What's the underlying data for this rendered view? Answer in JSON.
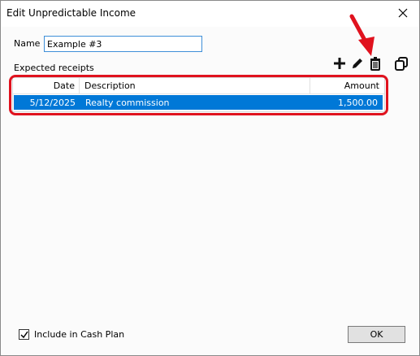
{
  "window": {
    "title": "Edit Unpredictable Income"
  },
  "form": {
    "name_label": "Name",
    "name_value": "Example #3",
    "expected_label": "Expected receipts"
  },
  "grid": {
    "columns": [
      "Date",
      "Description",
      "Amount"
    ],
    "rows": [
      {
        "date": "5/12/2025",
        "description": "Realty commission",
        "amount": "1,500.00",
        "selected": true
      }
    ]
  },
  "toolbar": {
    "icons": [
      "plus-icon",
      "pencil-icon",
      "trash-icon",
      "copy-icon"
    ]
  },
  "footer": {
    "include_label": "Include in Cash Plan",
    "include_checked": true,
    "ok_label": "OK"
  },
  "colors": {
    "selection": "#0078d7",
    "annotation": "#e0121e",
    "input_focus_border": "#3f8fd8"
  }
}
